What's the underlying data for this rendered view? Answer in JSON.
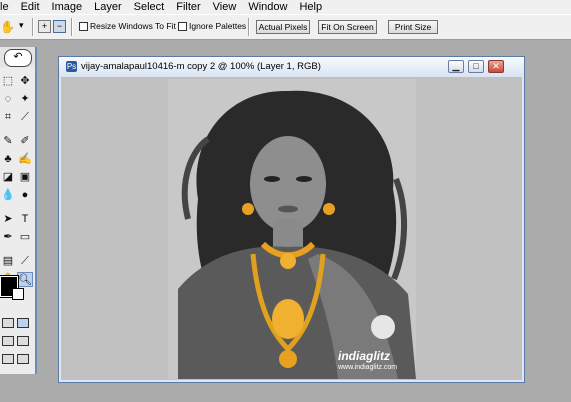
{
  "menu": {
    "items": [
      "le",
      "Edit",
      "Image",
      "Layer",
      "Select",
      "Filter",
      "View",
      "Window",
      "Help"
    ]
  },
  "options_bar": {
    "tool_icon": "hand-icon",
    "zoom_in_icon": "zoom-in-icon",
    "zoom_out_icon": "zoom-out-icon",
    "resize_windows_label": "Resize Windows To Fit",
    "ignore_palettes_label": "Ignore Palettes",
    "actual_pixels_label": "Actual Pixels",
    "fit_on_screen_label": "Fit On Screen",
    "print_size_label": "Print Size"
  },
  "document": {
    "title": "vijay-amalapaul10416-m copy 2 @ 100% (Layer 1, RGB)",
    "minimize": "▁",
    "maximize": "□",
    "close": "✕",
    "watermark": "indiaglitz",
    "watermark_url": "www.indiaglitz.com"
  },
  "colors": {
    "accent": "#5a7aa8",
    "workspace": "#ababab",
    "gold": "#e8a020"
  }
}
